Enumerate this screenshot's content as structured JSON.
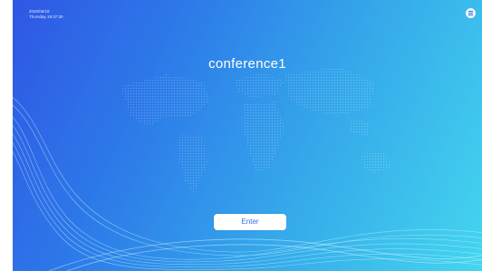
{
  "status": {
    "date": "2020/06/18",
    "weekday_time": "Thursday 19:37:30"
  },
  "room": {
    "name": "conference1"
  },
  "actions": {
    "enter_label": "Enter"
  },
  "icons": {
    "menu": "menu-icon"
  },
  "colors": {
    "gradient_start": "#2f57e4",
    "gradient_end": "#44d6ef",
    "button_text": "#2f6fe4"
  }
}
